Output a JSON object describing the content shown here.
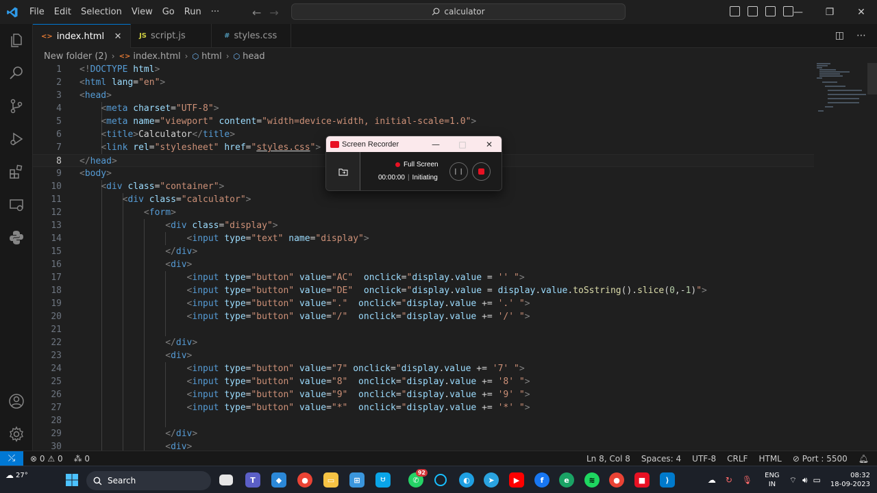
{
  "titlebar": {
    "menu": [
      "File",
      "Edit",
      "Selection",
      "View",
      "Go",
      "Run",
      "···"
    ],
    "search": "calculator"
  },
  "tabs": [
    {
      "icon": "<>",
      "label": "index.html",
      "active": true,
      "close": "✕"
    },
    {
      "icon": "JS",
      "label": "script.js",
      "active": false
    },
    {
      "icon": "#",
      "label": "styles.css",
      "active": false
    }
  ],
  "breadcrumb": [
    "New folder (2)",
    "index.html",
    "html",
    "head"
  ],
  "editor": {
    "current_line": 8,
    "line_numbers": [
      "1",
      "2",
      "3",
      "4",
      "5",
      "6",
      "7",
      "8",
      "9",
      "10",
      "11",
      "12",
      "13",
      "14",
      "15",
      "16",
      "17",
      "18",
      "19",
      "20",
      "21",
      "22",
      "23",
      "24",
      "25",
      "26",
      "27",
      "28",
      "29",
      "30"
    ]
  },
  "recorder": {
    "title": "Screen Recorder",
    "mode": "Full Screen",
    "time": "00:00:00",
    "state": "Initiating"
  },
  "statusbar": {
    "errors": "0",
    "warnings": "0",
    "ports_count": "0",
    "position": "Ln 8, Col 8",
    "spaces": "Spaces: 4",
    "encoding": "UTF-8",
    "eol": "CRLF",
    "language": "HTML",
    "port": "Port : 5500"
  },
  "taskbar": {
    "weather": "27°",
    "search_label": "Search",
    "whatsapp_badge": "92",
    "lang": "ENG",
    "region": "IN",
    "time": "08:32",
    "date": "18-09-2023"
  },
  "colors": {
    "accent": "#0078d4",
    "editor_bg": "#1f1f1f",
    "tag": "#569cd6",
    "attribute": "#9cdcfe",
    "string": "#ce9178",
    "record_red": "#e81123"
  }
}
